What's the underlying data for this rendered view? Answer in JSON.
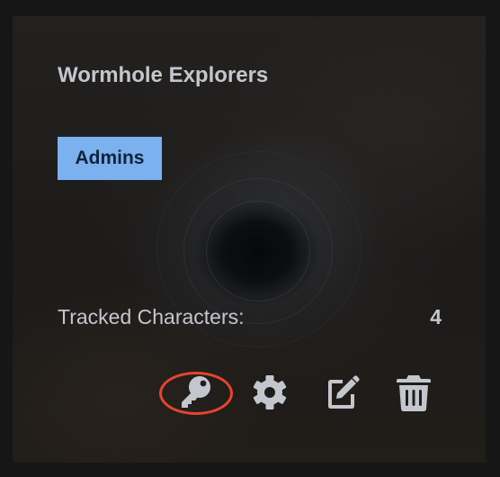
{
  "card": {
    "title": "Wormhole Explorers",
    "role_badge": "Admins",
    "stat_label": "Tracked Characters:",
    "stat_value": "4"
  },
  "actions": [
    {
      "icon": "key-icon",
      "highlighted": true
    },
    {
      "icon": "gear-icon",
      "highlighted": false
    },
    {
      "icon": "edit-icon",
      "highlighted": false
    },
    {
      "icon": "trash-icon",
      "highlighted": false
    }
  ],
  "colors": {
    "text": "#c3c7cd",
    "badge_bg": "#7ab1ee",
    "badge_text": "#10233a",
    "icon": "#c3c7cd",
    "highlight_ring": "#e8432f"
  }
}
